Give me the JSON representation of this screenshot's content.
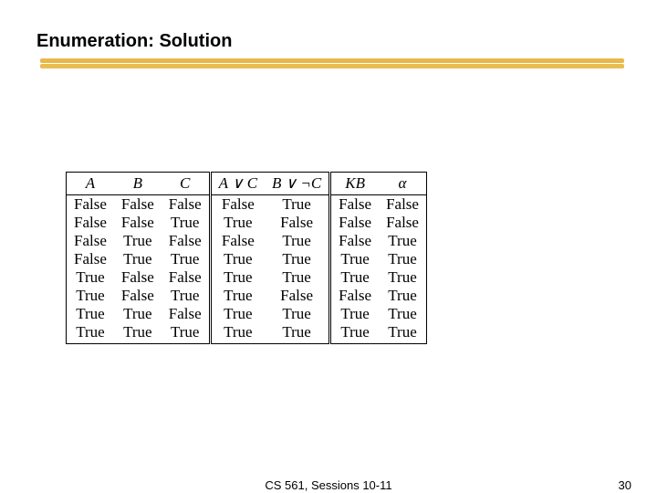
{
  "title": "Enumeration: Solution",
  "footer": {
    "course": "CS 561,  Sessions 10-11",
    "page": "30"
  },
  "table": {
    "headers": [
      "A",
      "B",
      "C",
      "A ∨ C",
      "B ∨ ¬C",
      "KB",
      "α"
    ],
    "rows": [
      [
        "False",
        "False",
        "False",
        "False",
        "True",
        "False",
        "False"
      ],
      [
        "False",
        "False",
        "True",
        "True",
        "False",
        "False",
        "False"
      ],
      [
        "False",
        "True",
        "False",
        "False",
        "True",
        "False",
        "True"
      ],
      [
        "False",
        "True",
        "True",
        "True",
        "True",
        "True",
        "True"
      ],
      [
        "True",
        "False",
        "False",
        "True",
        "True",
        "True",
        "True"
      ],
      [
        "True",
        "False",
        "True",
        "True",
        "False",
        "False",
        "True"
      ],
      [
        "True",
        "True",
        "False",
        "True",
        "True",
        "True",
        "True"
      ],
      [
        "True",
        "True",
        "True",
        "True",
        "True",
        "True",
        "True"
      ]
    ]
  },
  "chart_data": {
    "type": "table",
    "title": "Enumeration: Solution",
    "columns": [
      "A",
      "B",
      "C",
      "A ∨ C",
      "B ∨ ¬C",
      "KB",
      "α"
    ],
    "rows": [
      [
        "False",
        "False",
        "False",
        "False",
        "True",
        "False",
        "False"
      ],
      [
        "False",
        "False",
        "True",
        "True",
        "False",
        "False",
        "False"
      ],
      [
        "False",
        "True",
        "False",
        "False",
        "True",
        "False",
        "True"
      ],
      [
        "False",
        "True",
        "True",
        "True",
        "True",
        "True",
        "True"
      ],
      [
        "True",
        "False",
        "False",
        "True",
        "True",
        "True",
        "True"
      ],
      [
        "True",
        "False",
        "True",
        "True",
        "False",
        "False",
        "True"
      ],
      [
        "True",
        "True",
        "False",
        "True",
        "True",
        "True",
        "True"
      ],
      [
        "True",
        "True",
        "True",
        "True",
        "True",
        "True",
        "True"
      ]
    ]
  }
}
